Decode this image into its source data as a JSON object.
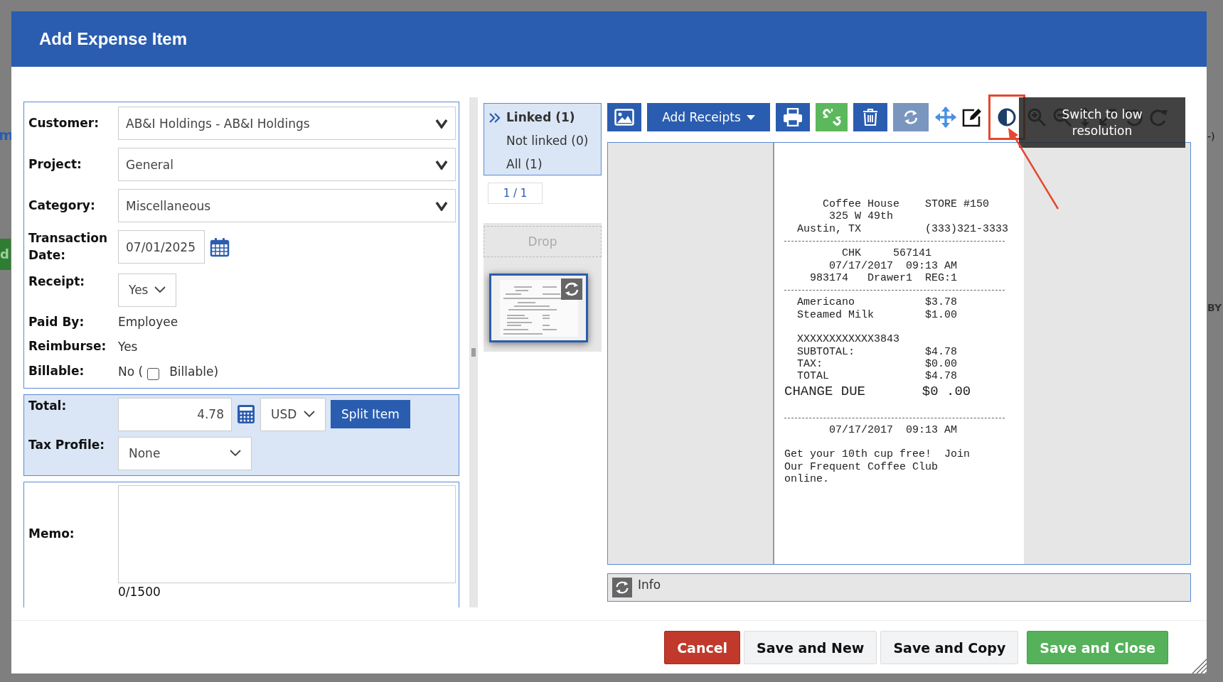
{
  "backdrop": {
    "left_fragments": [
      {
        "text": "m",
        "kind": "link"
      },
      {
        "text": "d",
        "kind": "button"
      }
    ],
    "right_fragments": [
      {
        "text": "-)"
      },
      {
        "text": "BY"
      }
    ]
  },
  "dialog": {
    "title": "Add Expense Item"
  },
  "form": {
    "fields": [
      {
        "label": "Customer:",
        "kind": "select",
        "value": "AB&I Holdings - AB&I Holdings"
      },
      {
        "label": "Project:",
        "kind": "select",
        "value": "General"
      },
      {
        "label": "Category:",
        "kind": "select",
        "value": "Miscellaneous"
      },
      {
        "label": "Transaction Date:",
        "kind": "date",
        "value": "07/01/2025"
      },
      {
        "label": "Receipt:",
        "kind": "small-select",
        "value": "Yes"
      },
      {
        "label": "Paid By:",
        "kind": "text",
        "value": "Employee"
      },
      {
        "label": "Reimburse:",
        "kind": "text",
        "value": "Yes"
      },
      {
        "label": "Billable:",
        "kind": "checkbox",
        "value": "No (",
        "checked": false,
        "after": "Billable)"
      }
    ]
  },
  "amount": {
    "label": "Total:",
    "value": "4.78",
    "currency": "USD",
    "split_button": "Split Item",
    "tax_label": "Tax Profile:",
    "tax_value": "None"
  },
  "memo": {
    "label": "Memo:",
    "counter": "0/1500"
  },
  "receipts": {
    "filters": [
      {
        "label": "Linked (1)",
        "selected": true
      },
      {
        "label": "Not linked (0)",
        "selected": false
      },
      {
        "label": "All (1)",
        "selected": false
      }
    ],
    "pager": "1 / 1",
    "drop": "Drop"
  },
  "toolbar": {
    "add_receipts": "Add Receipts",
    "tooltip": "Switch to low resolution"
  },
  "receipt_lines": [
    {
      "kind": "text",
      "text": "      Coffee House    STORE #150"
    },
    {
      "kind": "text",
      "text": "       325 W 49th"
    },
    {
      "kind": "text",
      "text": "  Austin, TX          (333)321-3333"
    },
    {
      "kind": "rule"
    },
    {
      "kind": "text",
      "text": "         CHK     567141"
    },
    {
      "kind": "text",
      "text": "       07/17/2017  09:13 AM"
    },
    {
      "kind": "text",
      "text": "    983174   Drawer1  REG:1"
    },
    {
      "kind": "rule"
    },
    {
      "kind": "text",
      "text": "  Americano           $3.78"
    },
    {
      "kind": "text",
      "text": "  Steamed Milk        $1.00"
    },
    {
      "kind": "gap"
    },
    {
      "kind": "text",
      "text": "  XXXXXXXXXXXX3843"
    },
    {
      "kind": "text",
      "text": "  SUBTOTAL:           $4.78"
    },
    {
      "kind": "text",
      "text": "  TAX:                $0.00"
    },
    {
      "kind": "text",
      "text": "  TOTAL               $4.78"
    },
    {
      "kind": "large",
      "text": "CHANGE DUE       $0 .00"
    },
    {
      "kind": "gap"
    },
    {
      "kind": "rule"
    },
    {
      "kind": "text",
      "text": "       07/17/2017  09:13 AM"
    },
    {
      "kind": "gap"
    },
    {
      "kind": "text",
      "text": "Get your 10th cup free!  Join"
    },
    {
      "kind": "text",
      "text": "Our Frequent Coffee Club"
    },
    {
      "kind": "text",
      "text": "online."
    }
  ],
  "info": {
    "label": "Info"
  },
  "buttons": [
    {
      "label": "Cancel",
      "kind": "danger"
    },
    {
      "label": "Save and New",
      "kind": "default"
    },
    {
      "label": "Save and Copy",
      "kind": "default"
    },
    {
      "label": "Save and Close",
      "kind": "success"
    }
  ]
}
